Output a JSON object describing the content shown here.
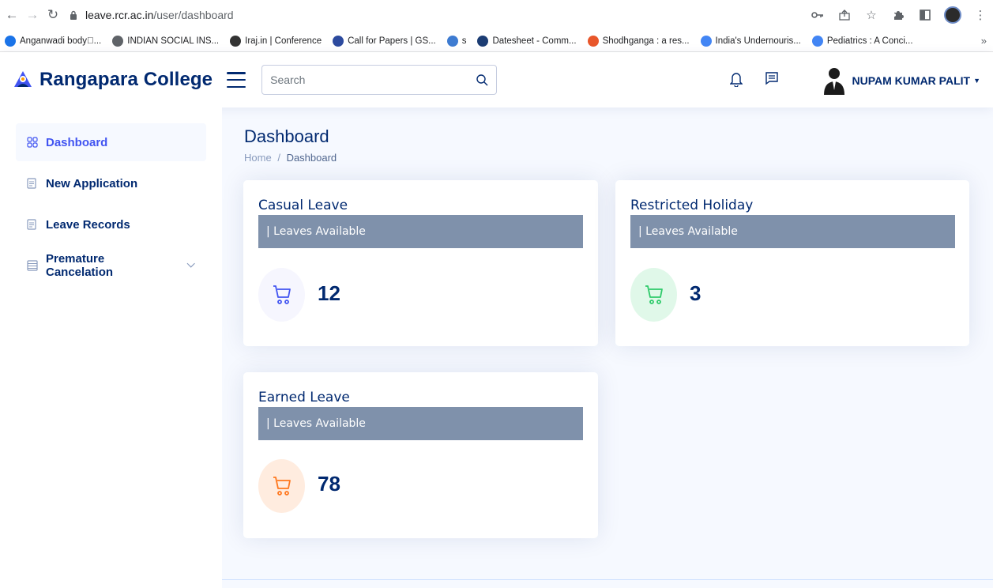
{
  "browser": {
    "url_host": "leave.rcr.ac.in",
    "url_path": "/user/dashboard",
    "bookmarks": [
      {
        "label": "Anganwadi body\u0000...",
        "icon": "globe-icon",
        "color": "#1a73e8"
      },
      {
        "label": "INDIAN SOCIAL INS...",
        "icon": "globe-icon",
        "color": "#5f6368"
      },
      {
        "label": "Iraj.in | Conference",
        "icon": "iraj-icon",
        "color": "#333333"
      },
      {
        "label": "Call for Papers | GS...",
        "icon": "un-icon",
        "color": "#2c4a9e"
      },
      {
        "label": "s",
        "icon": "site-icon",
        "color": "#3d7bd1"
      },
      {
        "label": "Datesheet - Comm...",
        "icon": "datesheet-icon",
        "color": "#1b3c73"
      },
      {
        "label": "Shodhganga : a res...",
        "icon": "shodhganga-icon",
        "color": "#e8562a"
      },
      {
        "label": "India's Undernouris...",
        "icon": "google-icon",
        "color": "#4285f4"
      },
      {
        "label": "Pediatrics : A Conci...",
        "icon": "google-icon",
        "color": "#4285f4"
      }
    ],
    "bookmarks_more": "»"
  },
  "header": {
    "brand": "Rangapara College",
    "search_placeholder": "Search",
    "user_name": "NUPAM KUMAR PALIT"
  },
  "sidebar": {
    "items": [
      {
        "label": "Dashboard",
        "icon": "grid-icon",
        "active": true
      },
      {
        "label": "New Application",
        "icon": "document-icon",
        "active": false
      },
      {
        "label": "Leave Records",
        "icon": "document-icon",
        "active": false
      },
      {
        "label": "Premature Cancelation",
        "icon": "list-icon",
        "active": false
      }
    ]
  },
  "main": {
    "title": "Dashboard",
    "breadcrumb": {
      "home": "Home",
      "sep": "/",
      "current": "Dashboard"
    },
    "cards": [
      {
        "title": "Casual Leave",
        "subtitle": "| Leaves Available",
        "value": "12",
        "accent": "#4154f1",
        "circle_bg": "#f6f6fe"
      },
      {
        "title": "Restricted Holiday",
        "subtitle": "| Leaves Available",
        "value": "3",
        "accent": "#2eca6a",
        "circle_bg": "#e0f8e9"
      },
      {
        "title": "Earned Leave",
        "subtitle": "| Leaves Available",
        "value": "78",
        "accent": "#ff771d",
        "circle_bg": "#ffecdf"
      }
    ]
  }
}
